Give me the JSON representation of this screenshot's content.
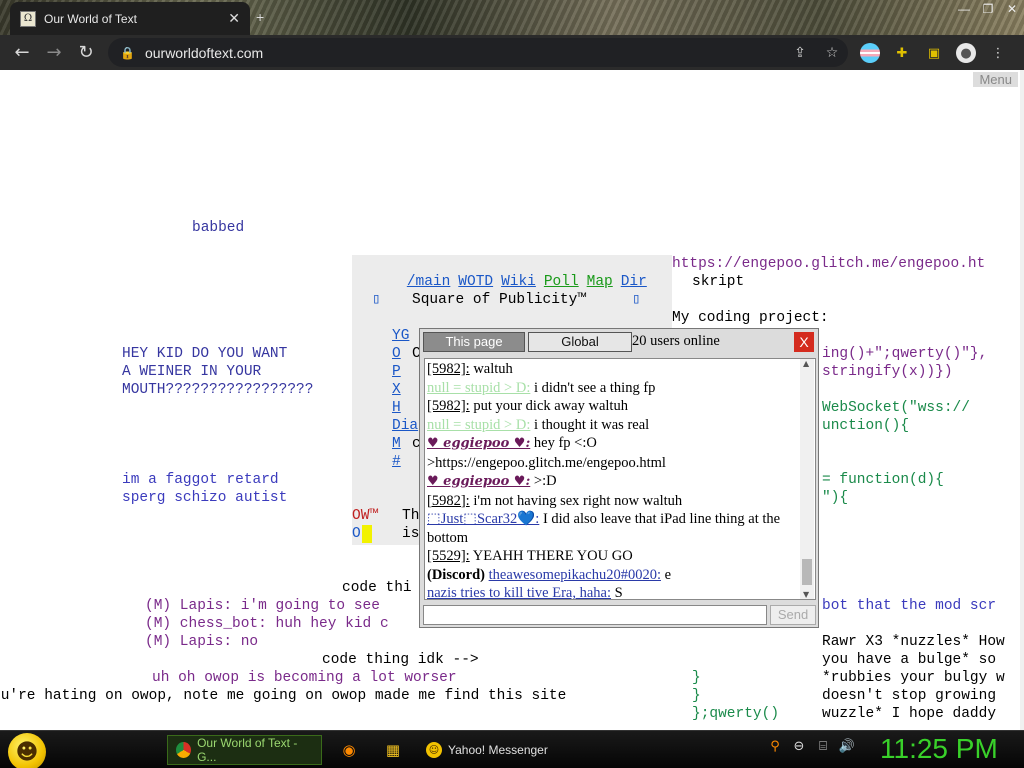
{
  "browser": {
    "tab_title": "Our World of Text",
    "tab_close": "✕",
    "new_tab": "+",
    "url": "ourworldoftext.com",
    "window_controls": [
      "—",
      "❐",
      "✕"
    ]
  },
  "page": {
    "menu_label": "Menu",
    "left_texts": {
      "babbed": "babbed",
      "hey_kid": [
        "HEY KID DO YOU WANT",
        "A WEINER IN YOUR",
        "MOUTH?????????????????"
      ],
      "retard": [
        "im a faggot retard",
        "sperg schizo autist"
      ],
      "code_thi": "code thi",
      "lapis1": "(M) Lapis: i'm going to see",
      "chess": "(M) chess_bot: huh hey kid c",
      "lapis2": "(M) Lapis: no",
      "code_thing": "code thing idk -->",
      "uhoh": "uh oh owop is becoming a lot worser",
      "hating": "ou're hating on owop, note me going on owop made me find this site"
    },
    "panel": {
      "links": [
        "/main",
        "WOTD",
        "Wiki",
        "Poll",
        "Map",
        "Dir"
      ],
      "green_links": [
        "Poll",
        "Map"
      ],
      "square_title": "Square of Publicity™",
      "letters": [
        "YG",
        "O",
        "P",
        "X",
        "H",
        "Dia",
        "M",
        "#"
      ],
      "tail_letters": [
        "C",
        "c"
      ],
      "ow": "OW™",
      "o": "O",
      "th": "Th",
      "is": "is"
    },
    "right_texts": {
      "url": "https://engepoo.glitch.me/engepoo.ht",
      "skript": "skript",
      "coding": "My coding project:",
      "r1": "ing()+\";qwerty()\"},",
      "r2": "stringify(x))})",
      "r3": "WebSocket(\"wss://",
      "r4": "unction(){",
      "r5": "= function(d){",
      "r6": "\"){",
      "bot": "bot that the mod scr",
      "rawr1": "Rawr X3 *nuzzles* How",
      "rawr2": "you have a bulge* so",
      "rawr3": "*rubbies your bulgy w",
      "rawr4": "doesn't stop growing",
      "rawr5": "wuzzle* I hope daddy",
      "brace1": "}",
      "brace2": "}",
      "qwerty": "};qwerty()"
    }
  },
  "chat": {
    "tab_this_page": "This page",
    "tab_global": "Global",
    "online": "20 users online",
    "close": "X",
    "send": "Send",
    "input_value": "",
    "messages": [
      {
        "user": "[5982]:",
        "text": " waltuh",
        "style": "u"
      },
      {
        "user": "null = stupid > D:",
        "text": " i didn't see a thing fp",
        "style": "faded"
      },
      {
        "user": "[5982]:",
        "text": " put your dick away waltuh",
        "style": "u"
      },
      {
        "user": "null = stupid > D:",
        "text": " i thought it was real",
        "style": "faded"
      },
      {
        "user": "♥ eggiepoo ♥:",
        "text": " hey fp <:O",
        "style": "heart"
      },
      {
        "user": "",
        "text": ">https://engepoo.glitch.me/engepoo.html",
        "style": "plain"
      },
      {
        "user": "♥ eggiepoo ♥:",
        "text": " >:D",
        "style": "heart"
      },
      {
        "user": "[5982]:",
        "text": " i'm not having sex right now waltuh",
        "style": "u"
      },
      {
        "user": "⬚Just⬚Scar32💙:",
        "text": " I did also leave that iPad line thing at the bottom",
        "style": "blue"
      },
      {
        "user": "[5529]:",
        "text": " YEAHH THERE YOU GO",
        "style": "u"
      },
      {
        "user": "(Discord) theawesomepikachu20#0020:",
        "text": " e",
        "style": "discord"
      },
      {
        "user": "nazis tries to kill tive Era, haha:",
        "text": " S",
        "style": "blue"
      }
    ]
  },
  "taskbar": {
    "task_chrome": "Our World of Text - G...",
    "task_yahoo": "Yahoo! Messenger",
    "clock": "11:25 PM"
  }
}
